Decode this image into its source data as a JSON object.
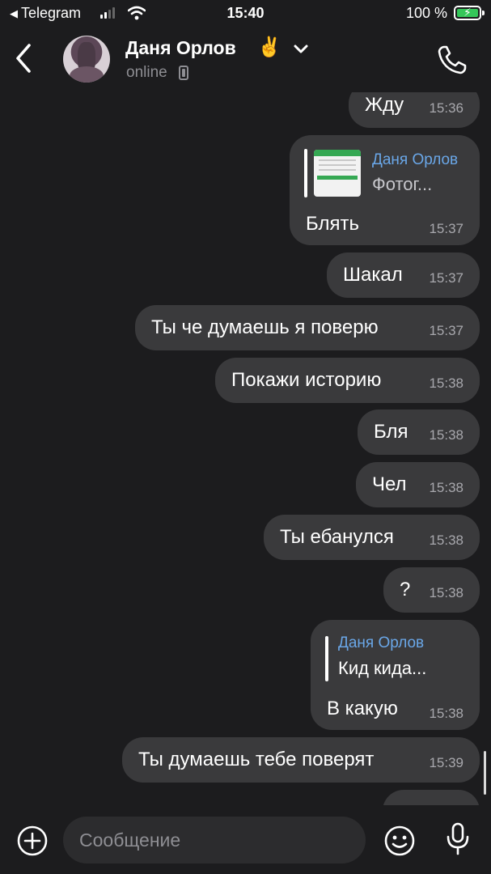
{
  "status_bar": {
    "back_app": "Telegram",
    "time": "15:40",
    "battery": "100 %"
  },
  "header": {
    "name": "Даня Орлов",
    "emoji": "✌️",
    "status": "online"
  },
  "messages": [
    {
      "text": "Жду",
      "time": "15:36"
    },
    {
      "reply_name": "Даня Орлов",
      "reply_text": "Фотог...",
      "text": "Блять",
      "time": "15:37"
    },
    {
      "text": "Шакал",
      "time": "15:37"
    },
    {
      "text": "Ты че думаешь я поверю",
      "time": "15:37"
    },
    {
      "text": "Покажи историю",
      "time": "15:38"
    },
    {
      "text": "Бля",
      "time": "15:38"
    },
    {
      "text": "Чел",
      "time": "15:38"
    },
    {
      "text": "Ты ебанулся",
      "time": "15:38"
    },
    {
      "text": "?",
      "time": "15:38"
    },
    {
      "reply_name": "Даня Орлов",
      "reply_text": "Кид кида...",
      "text": "В какую",
      "time": "15:38"
    },
    {
      "text": "Ты думаешь тебе поверят",
      "time": "15:39"
    }
  ],
  "input": {
    "placeholder": "Сообщение"
  }
}
